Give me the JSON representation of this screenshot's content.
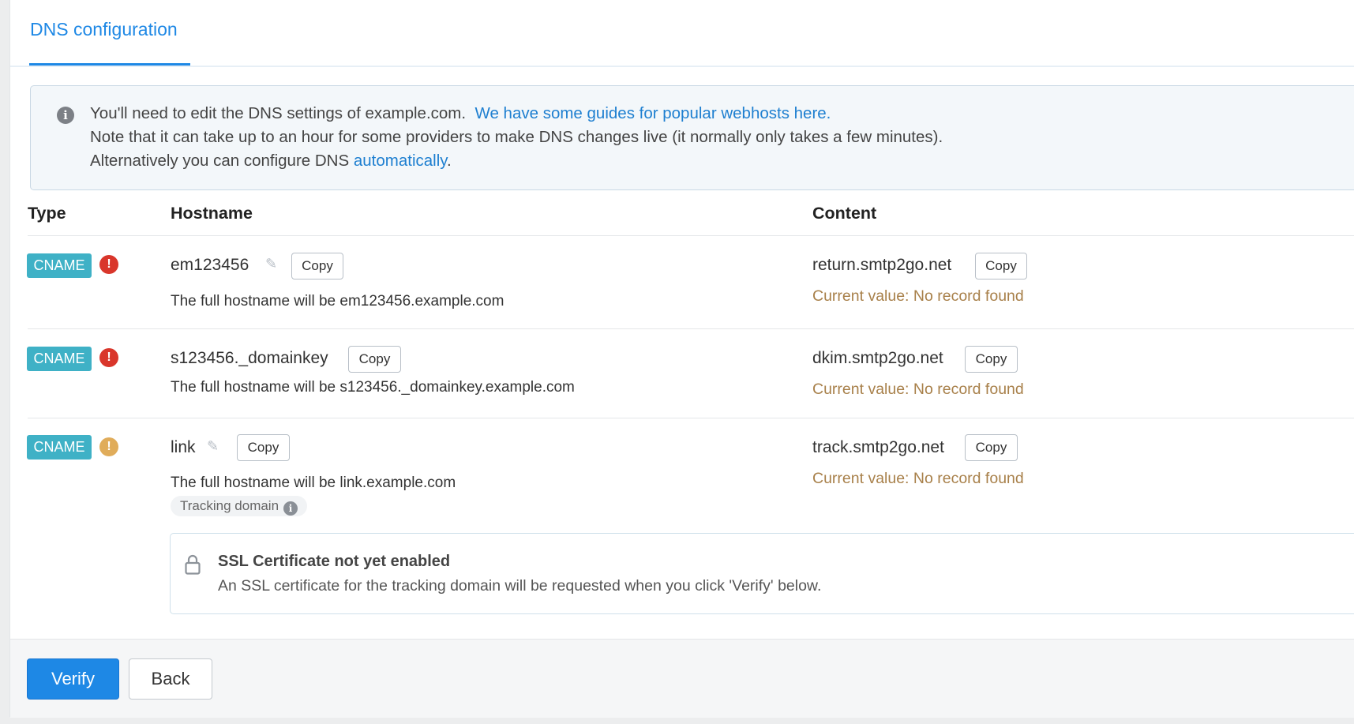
{
  "tab": {
    "label": "DNS configuration"
  },
  "info": {
    "line1_text": "You'll need to edit the DNS settings of example.com.",
    "line1_link": "We have some guides for popular webhosts here.",
    "line2_text": "Note that it can take up to an hour for some providers to make DNS changes live (it normally only takes a few minutes).",
    "line3_text": "Alternatively you can configure DNS",
    "line3_link": "automatically",
    "line3_end": "."
  },
  "table": {
    "headers": {
      "type": "Type",
      "hostname": "Hostname",
      "content": "Content"
    },
    "copy_label": "Copy",
    "rows": [
      {
        "type": "CNAME",
        "status": "error",
        "hostname": "em123456",
        "full_hostname": "The full hostname will be em123456.example.com",
        "content": "return.smtp2go.net",
        "current_value": "Current value: No record found"
      },
      {
        "type": "CNAME",
        "status": "error",
        "hostname": "s123456._domainkey",
        "full_hostname": "The full hostname will be s123456._domainkey.example.com",
        "content": "dkim.smtp2go.net",
        "current_value": "Current value: No record found"
      },
      {
        "type": "CNAME",
        "status": "warning",
        "hostname": "link",
        "full_hostname": "The full hostname will be link.example.com",
        "tag": "Tracking domain",
        "content": "track.smtp2go.net",
        "current_value": "Current value: No record found"
      }
    ]
  },
  "ssl": {
    "title": "SSL Certificate not yet enabled",
    "description": "An SSL certificate for the tracking domain will be requested when you click 'Verify' below."
  },
  "footer": {
    "verify_label": "Verify",
    "back_label": "Back"
  },
  "colors": {
    "accent": "#1e88e5",
    "badge": "#3fb1c6",
    "error": "#d9362b",
    "warning": "#e0ac5a",
    "current_value": "#a8804a"
  }
}
